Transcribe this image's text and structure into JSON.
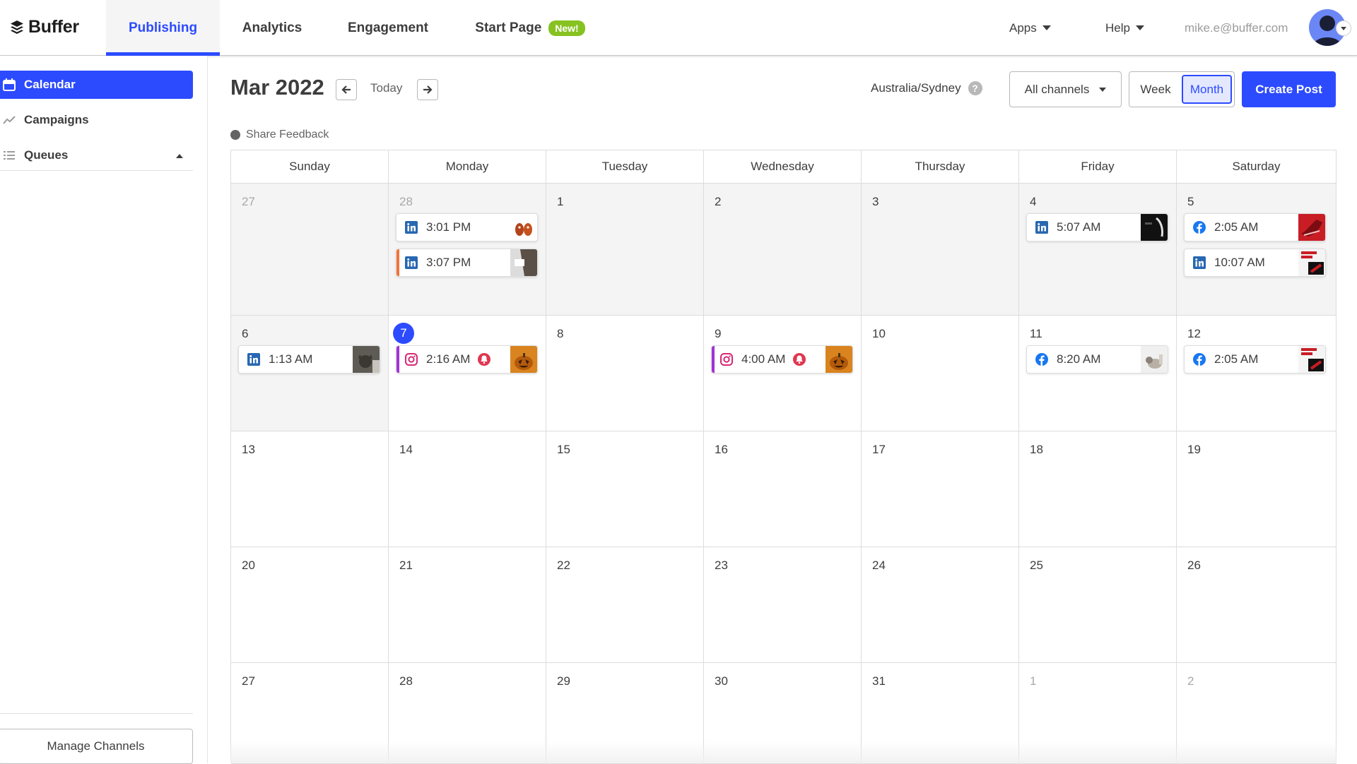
{
  "brand": {
    "name": "Buffer",
    "accent": "#2c4bff"
  },
  "topnav": {
    "tabs": [
      {
        "label": "Publishing",
        "active": true
      },
      {
        "label": "Analytics",
        "active": false
      },
      {
        "label": "Engagement",
        "active": false
      },
      {
        "label": "Start Page",
        "active": false,
        "badge": "New!"
      }
    ],
    "apps_label": "Apps",
    "help_label": "Help",
    "user_email": "mike.e@buffer.com"
  },
  "sidebar": {
    "items": [
      {
        "label": "Calendar",
        "icon": "calendar-icon",
        "active": true
      },
      {
        "label": "Campaigns",
        "icon": "trend-icon",
        "active": false
      },
      {
        "label": "Queues",
        "icon": "list-icon",
        "active": false,
        "expanded": true
      }
    ],
    "manage_channels_label": "Manage Channels"
  },
  "calendar": {
    "title": "Mar 2022",
    "today_label": "Today",
    "timezone": "Australia/Sydney",
    "help_glyph": "?",
    "channels_filter": "All channels",
    "view_week_label": "Week",
    "view_month_label": "Month",
    "active_view": "Month",
    "create_post_label": "Create Post",
    "feedback_label": "Share Feedback",
    "weekdays": [
      "Sunday",
      "Monday",
      "Tuesday",
      "Wednesday",
      "Thursday",
      "Friday",
      "Saturday"
    ],
    "weeks": [
      [
        {
          "day": "27",
          "muted": true,
          "past": true,
          "posts": []
        },
        {
          "day": "28",
          "muted": true,
          "past": true,
          "posts": [
            {
              "time": "3:01 PM",
              "network": "linkedin",
              "thumb": "shoes-thumb"
            },
            {
              "time": "3:07 PM",
              "network": "linkedin",
              "thumb": "dark-thumb",
              "accent": "#f2733a"
            }
          ]
        },
        {
          "day": "1",
          "past": true,
          "posts": []
        },
        {
          "day": "2",
          "past": true,
          "posts": []
        },
        {
          "day": "3",
          "past": true,
          "posts": []
        },
        {
          "day": "4",
          "past": true,
          "posts": [
            {
              "time": "5:07 AM",
              "network": "linkedin",
              "thumb": "black-thumb"
            }
          ]
        },
        {
          "day": "5",
          "past": true,
          "posts": [
            {
              "time": "2:05 AM",
              "network": "facebook",
              "thumb": "red-shoe-thumb"
            },
            {
              "time": "10:07 AM",
              "network": "linkedin",
              "thumb": "sale-thumb"
            }
          ]
        }
      ],
      [
        {
          "day": "6",
          "past": true,
          "posts": [
            {
              "time": "1:13 AM",
              "network": "linkedin",
              "thumb": "cat-thumb"
            }
          ]
        },
        {
          "day": "7",
          "today": true,
          "posts": [
            {
              "time": "2:16 AM",
              "network": "instagram",
              "thumb": "pumpkin-thumb",
              "accent": "#a033d6",
              "alert": true
            }
          ]
        },
        {
          "day": "8",
          "posts": []
        },
        {
          "day": "9",
          "posts": [
            {
              "time": "4:00 AM",
              "network": "instagram",
              "thumb": "pumpkin-thumb",
              "accent": "#a033d6",
              "alert": true
            }
          ]
        },
        {
          "day": "10",
          "posts": []
        },
        {
          "day": "11",
          "posts": [
            {
              "time": "8:20 AM",
              "network": "facebook",
              "thumb": "light-thumb"
            }
          ]
        },
        {
          "day": "12",
          "posts": [
            {
              "time": "2:05 AM",
              "network": "facebook",
              "thumb": "sale-thumb"
            }
          ]
        }
      ],
      [
        {
          "day": "13",
          "posts": []
        },
        {
          "day": "14",
          "posts": []
        },
        {
          "day": "15",
          "posts": []
        },
        {
          "day": "16",
          "posts": []
        },
        {
          "day": "17",
          "posts": []
        },
        {
          "day": "18",
          "posts": []
        },
        {
          "day": "19",
          "posts": []
        }
      ],
      [
        {
          "day": "20",
          "posts": []
        },
        {
          "day": "21",
          "posts": []
        },
        {
          "day": "22",
          "posts": []
        },
        {
          "day": "23",
          "posts": []
        },
        {
          "day": "24",
          "posts": []
        },
        {
          "day": "25",
          "posts": []
        },
        {
          "day": "26",
          "posts": []
        }
      ],
      [
        {
          "day": "27",
          "posts": []
        },
        {
          "day": "28",
          "posts": []
        },
        {
          "day": "29",
          "posts": []
        },
        {
          "day": "30",
          "posts": []
        },
        {
          "day": "31",
          "posts": []
        },
        {
          "day": "1",
          "muted": true,
          "posts": []
        },
        {
          "day": "2",
          "muted": true,
          "posts": []
        }
      ]
    ]
  },
  "colors": {
    "linkedin": "#2867b2",
    "facebook": "#1877f2",
    "instagram": "#d62976",
    "alert": "#e0364f",
    "badge_green": "#87c221"
  }
}
